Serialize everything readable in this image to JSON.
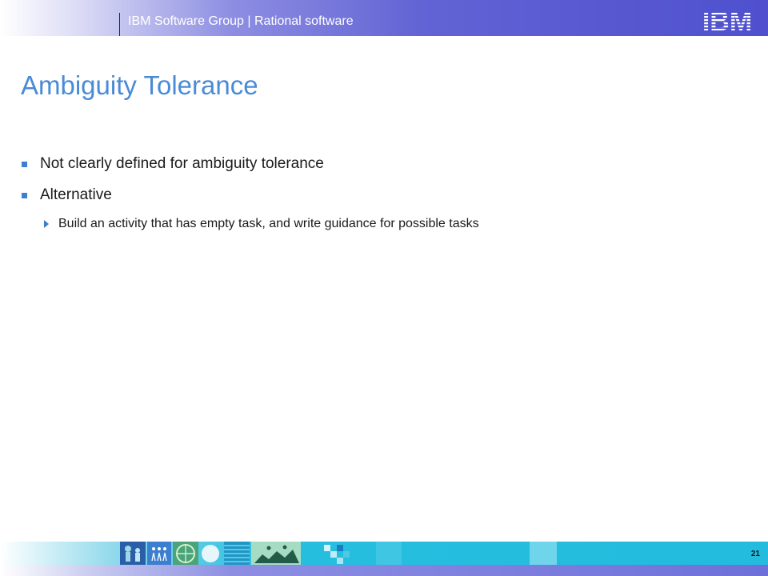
{
  "header": {
    "title": "IBM Software Group | Rational software",
    "logo_text": "IBM"
  },
  "slide": {
    "title": "Ambiguity Tolerance",
    "bullets": [
      {
        "text": "Not clearly defined for ambiguity tolerance"
      },
      {
        "text": "Alternative",
        "sub": [
          {
            "text": "Build an activity that has empty task, and write guidance for possible tasks"
          }
        ]
      }
    ]
  },
  "footer": {
    "page_number": "21"
  },
  "colors": {
    "title": "#4a8bd6",
    "bullet": "#3c7fd0",
    "header": "#5557d0",
    "footer": "#24bcde"
  }
}
